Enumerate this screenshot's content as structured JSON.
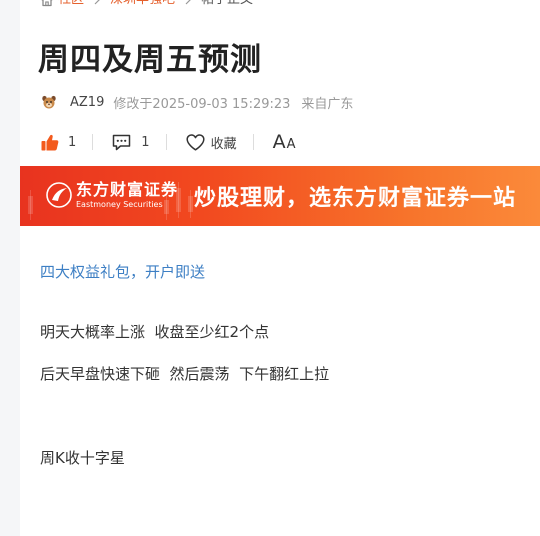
{
  "breadcrumb": {
    "items": [
      "社区",
      "深圳华强吧",
      "帖子正文"
    ]
  },
  "post": {
    "title": "周四及周五预测",
    "author": "AZ19",
    "modified": "修改于2025-09-03 15:29:23",
    "location": "来自广东"
  },
  "actions": {
    "like_count": "1",
    "comment_count": "1",
    "favorite_label": "收藏",
    "font_size_big": "A",
    "font_size_small": "A"
  },
  "banner": {
    "brand_cn": "东方财富证券",
    "brand_en": "Eastmoney Securities",
    "slogan": "炒股理财，选东方财富证券一站"
  },
  "promo_link": "四大权益礼包，开户即送",
  "content": {
    "paragraphs": [
      "明天大概率上涨  收盘至少红2个点",
      "后天早盘快速下砸  然后震荡  下午翻红上拉",
      "周K收十字星"
    ]
  },
  "colors": {
    "accent": "#e5612e",
    "link": "#3d7fc4",
    "banner_start": "#e8331f",
    "banner_end": "#fb8a3a"
  }
}
